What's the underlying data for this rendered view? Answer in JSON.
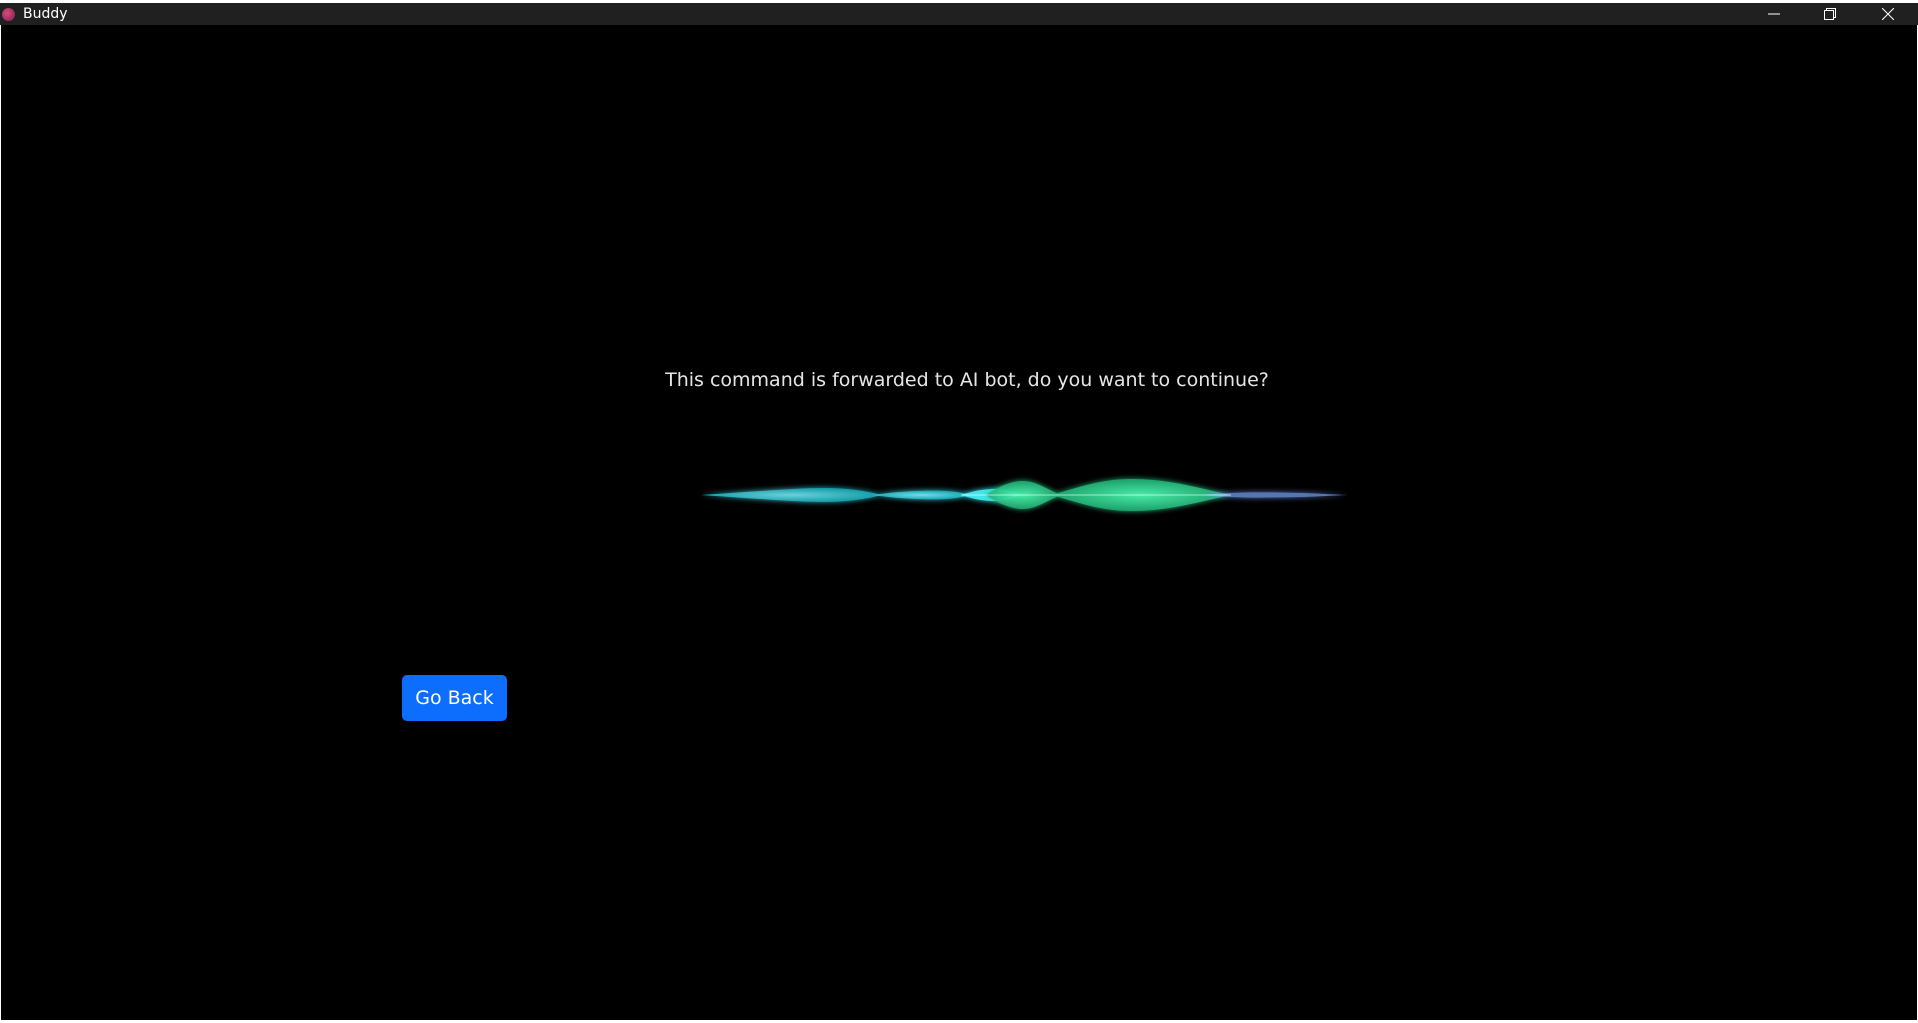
{
  "window": {
    "title": "Buddy",
    "controls": {
      "minimize_icon": "minimize-icon",
      "maximize_icon": "restore-icon",
      "close_icon": "close-icon"
    }
  },
  "main": {
    "prompt": "This command is forwarded to AI bot, do you want to continue?",
    "go_back_label": "Go Back",
    "visual": "voice-waveform"
  },
  "colors": {
    "background": "#000000",
    "titlebar": "#202020",
    "button_primary": "#0d6efd",
    "wave_cyan": "#40e8f0",
    "wave_green": "#3ddc97",
    "wave_blue": "#7aa8ff"
  }
}
